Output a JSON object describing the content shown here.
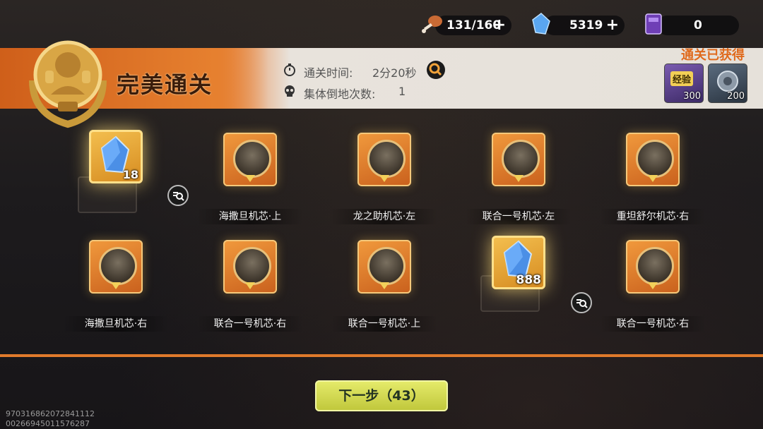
{
  "resources": [
    {
      "name": "stamina",
      "value": "131/160",
      "plus": "+",
      "icon": "drumstick-icon"
    },
    {
      "name": "crystal",
      "value": "5319",
      "plus": "+",
      "icon": "blue-crystal-icon"
    },
    {
      "name": "ticket",
      "value": "0",
      "icon": "purple-ticket-icon"
    }
  ],
  "header": {
    "title": "完美通关",
    "clear_time_label": "通关时间:",
    "clear_time_value": "2分20秒",
    "knockdown_label": "集体倒地次数:",
    "knockdown_value": "1",
    "obtained_title": "通关已获得",
    "rewards": [
      {
        "label": "经验",
        "value": "300",
        "icon": "exp-badge-icon"
      },
      {
        "value": "200",
        "icon": "gear-coin-icon"
      }
    ]
  },
  "items": [
    {
      "type": "crystal",
      "qty": "18",
      "label": ""
    },
    {
      "type": "core",
      "label": "海撒旦机芯·上"
    },
    {
      "type": "core",
      "label": "龙之助机芯·左"
    },
    {
      "type": "core",
      "label": "联合一号机芯·左"
    },
    {
      "type": "core",
      "label": "重坦舒尔机芯·右"
    },
    {
      "type": "core",
      "label": "海撒旦机芯·右"
    },
    {
      "type": "core",
      "label": "联合一号机芯·右"
    },
    {
      "type": "core",
      "label": "联合一号机芯·上"
    },
    {
      "type": "crystal",
      "qty": "888",
      "label": ""
    },
    {
      "type": "core",
      "label": "联合一号机芯·右"
    }
  ],
  "next_button": "下一步（43）",
  "ids": [
    "970316862072841112",
    "00266945011576287"
  ],
  "colors": {
    "accent": "#e8772a",
    "button": "#d6dc52",
    "gold": "#f4c050"
  }
}
